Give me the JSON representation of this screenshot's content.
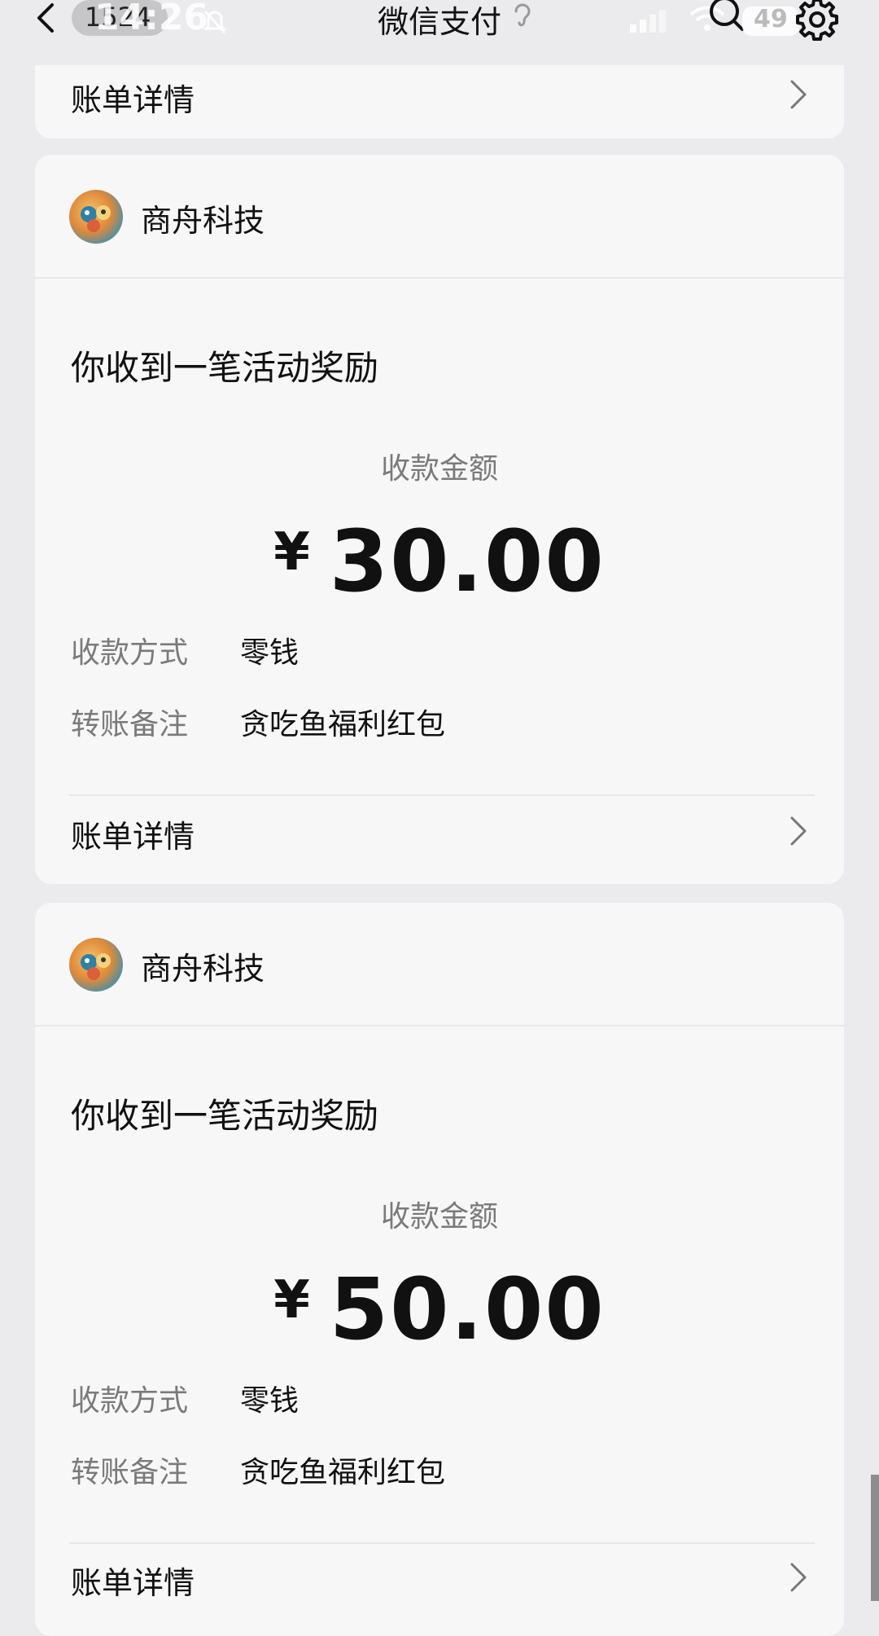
{
  "status_bar": {
    "unread_count": "1524",
    "clock": "14:26",
    "battery": "49"
  },
  "nav": {
    "title": "微信支付"
  },
  "top_card": {
    "bill_label": "账单详情"
  },
  "messages": [
    {
      "merchant": "商舟科技",
      "headline": "你收到一笔活动奖励",
      "amount_label": "收款金额",
      "currency": "¥",
      "amount": "30.00",
      "method_label": "收款方式",
      "method_value": "零钱",
      "note_label": "转账备注",
      "note_value": "贪吃鱼福利红包",
      "bill_label": "账单详情"
    },
    {
      "merchant": "商舟科技",
      "headline": "你收到一笔活动奖励",
      "amount_label": "收款金额",
      "currency": "¥",
      "amount": "50.00",
      "method_label": "收款方式",
      "method_value": "零钱",
      "note_label": "转账备注",
      "note_value": "贪吃鱼福利红包",
      "bill_label": "账单详情"
    }
  ]
}
